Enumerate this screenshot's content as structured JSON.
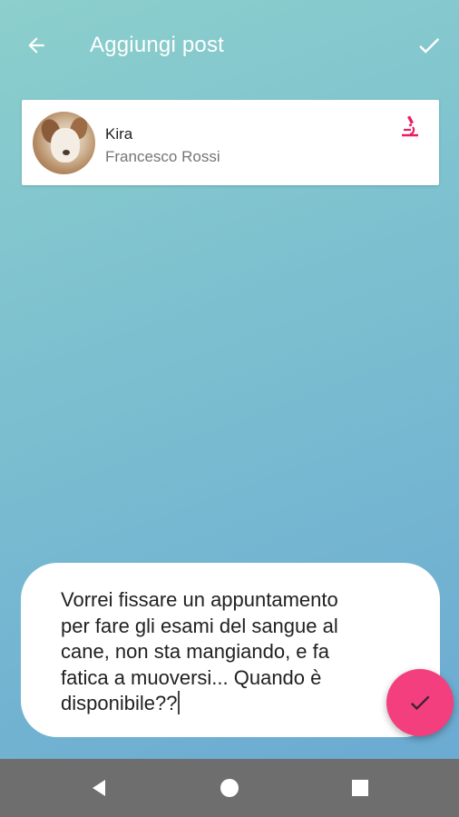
{
  "app_bar": {
    "title": "Aggiungi post",
    "back_icon": "arrow-left-icon",
    "confirm_icon": "check-icon"
  },
  "pet_card": {
    "pet_name": "Kira",
    "owner_name": "Francesco Rossi",
    "category_icon": "microscope-icon",
    "accent_color": "#e91e63"
  },
  "message": {
    "text": "Vorrei fissare un appuntamento\nper fare gli esami del sangue al\ncane, non sta mangiando, e fa\nfatica a muoversi... Quando è\ndisponibile??"
  },
  "fab": {
    "icon": "check-icon",
    "color": "#f43f7e"
  },
  "system_nav": {
    "back_icon": "triangle-back-icon",
    "home_icon": "circle-home-icon",
    "recents_icon": "square-recents-icon"
  }
}
